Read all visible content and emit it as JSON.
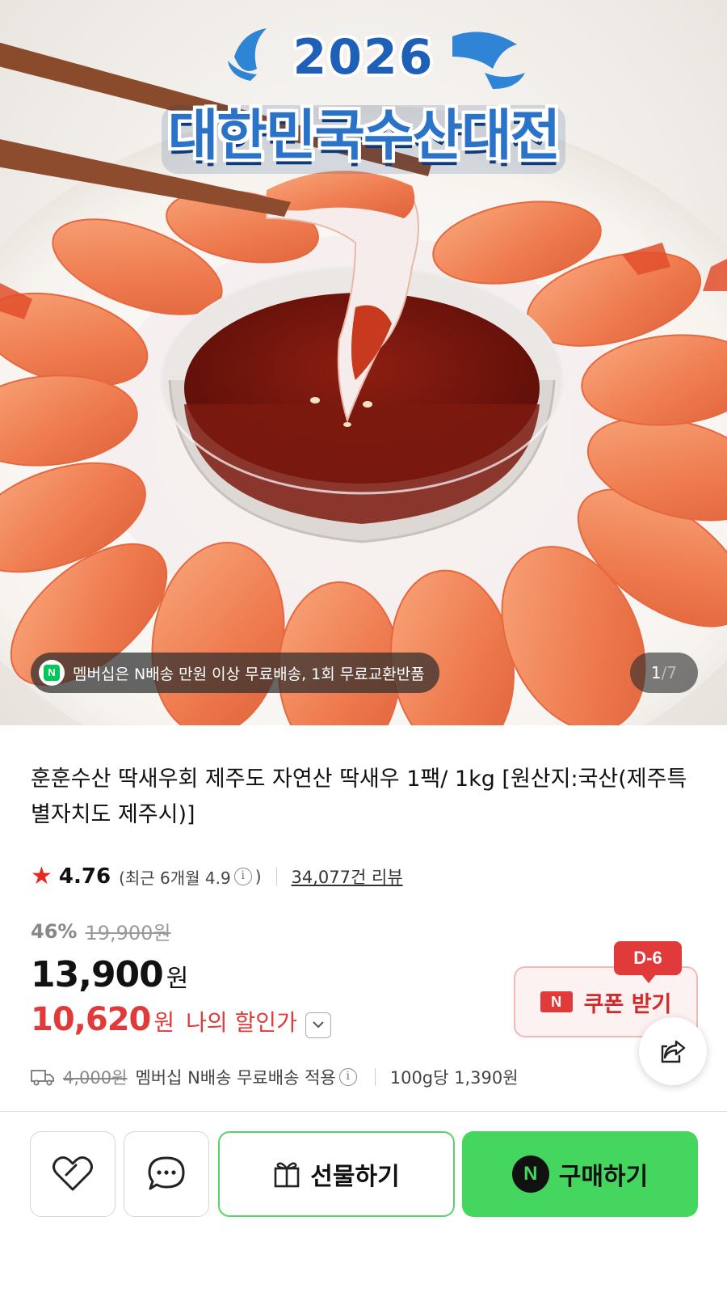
{
  "hero": {
    "event_year": "2026",
    "event_name": "대한민국수산대전",
    "membership_notice": "멤버십은 N배송 만원 이상 무료배송, 1회 무료교환반품",
    "membership_badge_icon": "naver-n-icon",
    "page_current": "1",
    "page_total": "/7"
  },
  "product": {
    "title": "훈훈수산 딱새우회 제주도 자연산 딱새우 1팩/ 1kg [원산지:국산(제주특별자치도 제주시)]",
    "rating": "4.76",
    "rating_recent_open": "(최근 6개월 4.9",
    "rating_recent_close": ")",
    "info_icon_glyph": "i",
    "review_count": "34,077건 리뷰"
  },
  "price": {
    "discount_rate": "46%",
    "original_price": "19,900원",
    "sale_price": "13,900",
    "currency": "원",
    "my_price": "10,620",
    "my_price_currency": "원",
    "my_price_label": "나의 할인가",
    "expand_icon": "chevron-down-icon"
  },
  "coupon": {
    "dday": "D-6",
    "badge": "N",
    "label": "쿠폰 받기"
  },
  "shipping": {
    "original_fee": "4,000원",
    "notice": "멤버십 N배송 무료배송 적용",
    "unit_price": "100g당 1,390원"
  },
  "actions": {
    "wishlist_icon": "heart-icon",
    "talk_icon": "chat-bubble-icon",
    "gift_label": "선물하기",
    "buy_label": "구매하기",
    "buy_badge": "N"
  },
  "colors": {
    "brand_green": "#44d65e",
    "sale_red": "#e03a3a",
    "event_blue": "#2a73c9"
  }
}
